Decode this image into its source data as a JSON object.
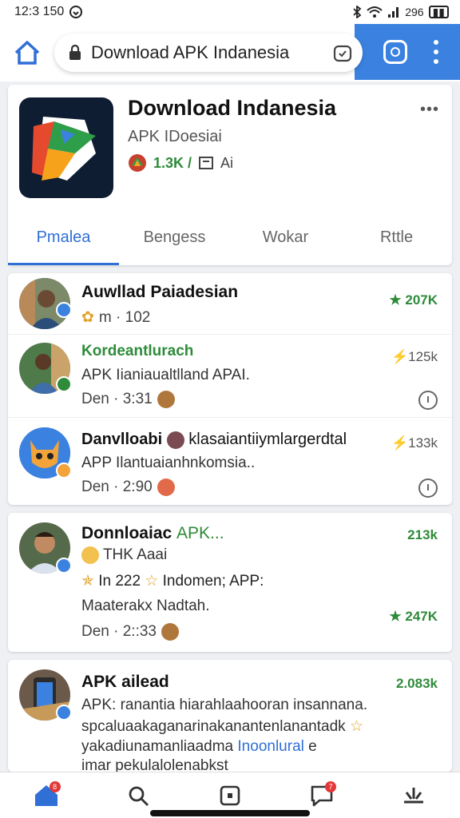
{
  "status": {
    "time": "12:3 150",
    "right": "296"
  },
  "browser": {
    "url": "Download APK Indanesia"
  },
  "app": {
    "title": "Download Indanesia",
    "subtitle": "APK IDoesiai",
    "rating": "1.3K /",
    "downloads": "Ai",
    "tabs": [
      "Pmalea",
      "Bengess",
      "Wokar",
      "Rttle"
    ]
  },
  "feed": [
    {
      "name": "Auwllad Paiadesian",
      "meta": "m · 102",
      "count": "207K"
    },
    {
      "name": "Kordeantlurach",
      "text": "APK Iianiaualtlland APAI.",
      "meta": "Den · 3:31",
      "count": "125k"
    },
    {
      "name": "Danvlloabi",
      "name_suffix": "klasaiantiiymlargerdtal",
      "text": "APP Ilantuaianhnkomsia..",
      "meta": "Den · 2:90",
      "count": "133k"
    },
    {
      "name": "Donnloaiac",
      "name_suffix": "APK...",
      "line1": "THK Aaai",
      "line2_a": "In 222",
      "line2_b": "Indomen; APP:",
      "line3": "Maaterakx Nadtah.",
      "meta": "Den · 2::33",
      "count": "213k",
      "count2": "247K"
    },
    {
      "name": "APK ailead",
      "count": "2.083k",
      "line1": "APK: ranantia hiarahlaahooran insannana.",
      "line2": "spcaluaakaganarinakanantenlanantadk",
      "line3_a": "yakadiunamanliaadma",
      "line3_b": "Inoonlural",
      "line3_c": "e",
      "line4": "imar pekulalolenabkst"
    }
  ],
  "colors": {
    "accent": "#2f6fd6",
    "green": "#2e8b3a",
    "browser_blue": "#3b82e0"
  },
  "nav": {
    "notif_badge": "8",
    "chat_badge": "7"
  }
}
